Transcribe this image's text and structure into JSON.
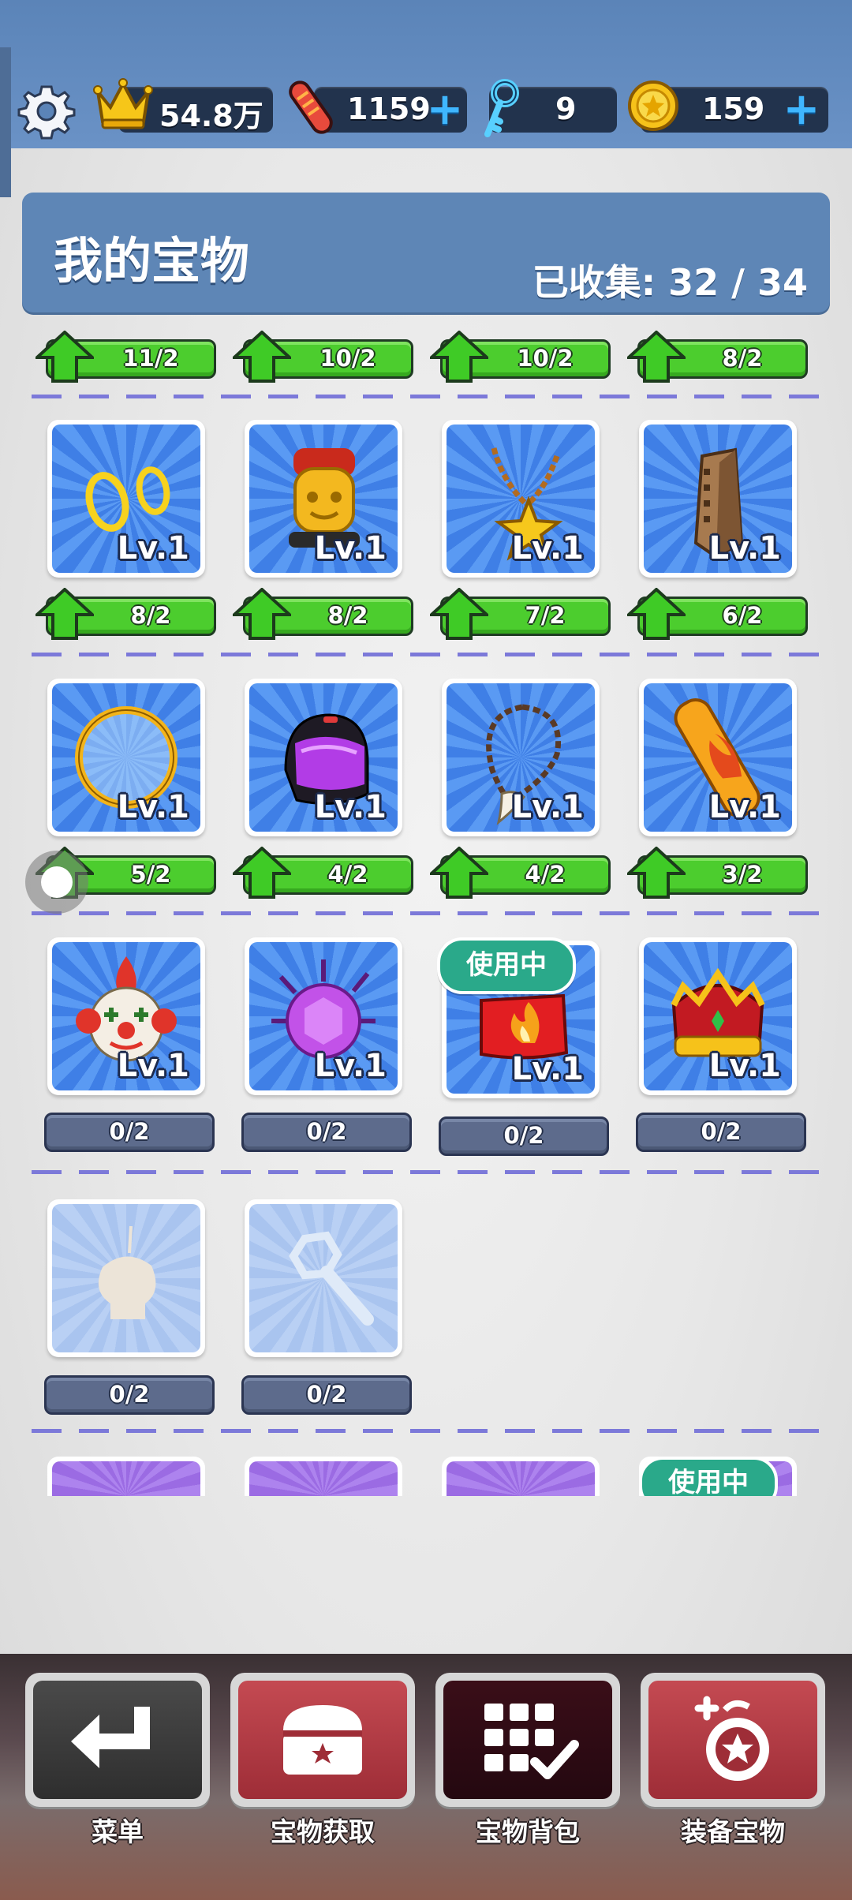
{
  "topbar": {
    "score": "54.8万",
    "boards": "1159",
    "keys": "9",
    "coins": "159"
  },
  "header": {
    "title": "我的宝物",
    "collected_label": "已收集:",
    "collected_value": "32 / 34"
  },
  "top_progress": [
    "11/2",
    "10/2",
    "10/2",
    "8/2"
  ],
  "rows": [
    {
      "items": [
        {
          "name": "金耳环",
          "level": "Lv.1",
          "progress": "8/2",
          "in_use": false,
          "upgradable": true
        },
        {
          "name": "金头像",
          "level": "Lv.1",
          "progress": "8/2",
          "in_use": false,
          "upgradable": true
        },
        {
          "name": "星星项链",
          "level": "Lv.1",
          "progress": "7/2",
          "in_use": false,
          "upgradable": true
        },
        {
          "name": "大楼",
          "level": "Lv.1",
          "progress": "6/2",
          "in_use": false,
          "upgradable": true
        }
      ]
    },
    {
      "items": [
        {
          "name": "光环",
          "level": "Lv.1",
          "progress": "5/2",
          "in_use": false,
          "upgradable": true
        },
        {
          "name": "头盔",
          "level": "Lv.1",
          "progress": "4/2",
          "in_use": false,
          "upgradable": true
        },
        {
          "name": "牙齿项链",
          "level": "Lv.1",
          "progress": "4/2",
          "in_use": false,
          "upgradable": true
        },
        {
          "name": "火焰滑板",
          "level": "Lv.1",
          "progress": "3/2",
          "in_use": false,
          "upgradable": true
        }
      ]
    },
    {
      "items": [
        {
          "name": "小丑面具",
          "level": "Lv.1",
          "progress": "0/2",
          "in_use": false,
          "upgradable": false
        },
        {
          "name": "紫色宝石",
          "level": "Lv.1",
          "progress": "0/2",
          "in_use": false,
          "upgradable": false
        },
        {
          "name": "火焰帽",
          "level": "Lv.1",
          "progress": "0/2",
          "in_use": true,
          "upgradable": false
        },
        {
          "name": "王冠",
          "level": "Lv.1",
          "progress": "0/2",
          "in_use": false,
          "upgradable": false
        }
      ]
    },
    {
      "items": [
        {
          "name": "骷髅",
          "level": "",
          "progress": "0/2",
          "in_use": false,
          "upgradable": false
        },
        {
          "name": "扳手",
          "level": "",
          "progress": "0/2",
          "in_use": false,
          "upgradable": false
        }
      ]
    }
  ],
  "in_use_label": "使用中",
  "nav": {
    "menu": "菜单",
    "obtain": "宝物获取",
    "backpack": "宝物背包",
    "equip": "装备宝物"
  },
  "colors": {
    "header_blue": "#5e86b6",
    "progress_green": "#4ccd2e",
    "progress_gray": "#5d6b8c",
    "in_use_teal": "#2aa98a"
  }
}
